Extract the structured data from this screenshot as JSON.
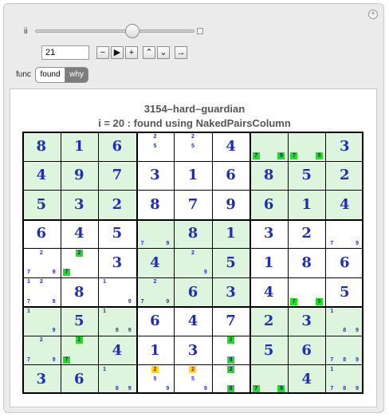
{
  "controls": {
    "slider_label": "ii",
    "slider_position": 0.62,
    "input_value": "21",
    "buttons": [
      "−",
      "▶",
      "+",
      "⌃",
      "⌄",
      "→"
    ],
    "func_label": "func",
    "func_options": [
      "found",
      "why"
    ],
    "func_selected": "why"
  },
  "title": "3154–hard–guardian",
  "subtitle": "i = 20 : found using NakedPairsColumn",
  "colors": {
    "cell_green": "#dcf5dc",
    "digit_blue": "#1f2fb5",
    "highlight_green": "#1fe01f",
    "highlight_yellow": "#ffe000"
  },
  "grid": [
    [
      "8",
      "1",
      "6",
      {
        "c": [
          "2",
          "5"
        ]
      },
      {
        "c": [
          "2",
          "5"
        ]
      },
      "4",
      {
        "c": [
          "7",
          "9"
        ],
        "hl": {
          "7": "g",
          "9": "g"
        }
      },
      {
        "c": [
          "7",
          "9"
        ],
        "hl": {
          "7": "g",
          "9": "g"
        }
      },
      "3"
    ],
    [
      "4",
      "9",
      "7",
      "3",
      "1",
      "6",
      "8",
      "5",
      "2"
    ],
    [
      "5",
      "3",
      "2",
      "8",
      "7",
      "9",
      "6",
      "1",
      "4"
    ],
    [
      "6",
      "4",
      "5",
      {
        "c": [
          "7",
          "9"
        ]
      },
      "8",
      "1",
      "3",
      "2",
      {
        "c": [
          "7",
          "9"
        ]
      }
    ],
    [
      {
        "c": [
          "2",
          "7",
          "9"
        ]
      },
      {
        "c": [
          "2",
          "7"
        ],
        "hl": {
          "2": "g",
          "7": "g"
        }
      },
      "3",
      "4",
      {
        "c": [
          "2",
          "9"
        ]
      },
      "5",
      "1",
      "8",
      "6"
    ],
    [
      {
        "c": [
          "1",
          "2",
          "7",
          "9"
        ]
      },
      "8",
      {
        "c": [
          "1",
          "9"
        ]
      },
      {
        "c": [
          "2",
          "7",
          "9"
        ]
      },
      "6",
      "3",
      "4",
      {
        "c": [
          "7",
          "9"
        ],
        "hl": {
          "7": "g",
          "9": "g"
        }
      },
      "5"
    ],
    [
      {
        "c": [
          "1",
          "9"
        ]
      },
      "5",
      {
        "c": [
          "1",
          "8",
          "9"
        ]
      },
      "6",
      "4",
      "7",
      "2",
      "3",
      {
        "c": [
          "1",
          "8",
          "9"
        ]
      }
    ],
    [
      {
        "c": [
          "2",
          "7",
          "9"
        ]
      },
      {
        "c": [
          "2",
          "7"
        ],
        "hl": {
          "2": "g",
          "7": "g"
        }
      },
      "4",
      "1",
      "3",
      {
        "c": [
          "2",
          "8"
        ],
        "hl": {
          "2": "g",
          "8": "g"
        }
      },
      "5",
      "6",
      {
        "c": [
          "7",
          "8",
          "9"
        ]
      }
    ],
    [
      "3",
      "6",
      {
        "c": [
          "1",
          "8",
          "9"
        ]
      },
      {
        "c": [
          "2",
          "5",
          "9"
        ],
        "hl": {
          "2": "y"
        }
      },
      {
        "c": [
          "2",
          "5",
          "9"
        ],
        "hl": {
          "2": "y"
        }
      },
      {
        "c": [
          "2",
          "8"
        ],
        "hl": {
          "2": "g",
          "8": "g"
        }
      },
      {
        "c": [
          "7",
          "9"
        ],
        "hl": {
          "7": "g",
          "9": "g"
        }
      },
      "4",
      {
        "c": [
          "1",
          "7",
          "8",
          "9"
        ]
      }
    ]
  ]
}
